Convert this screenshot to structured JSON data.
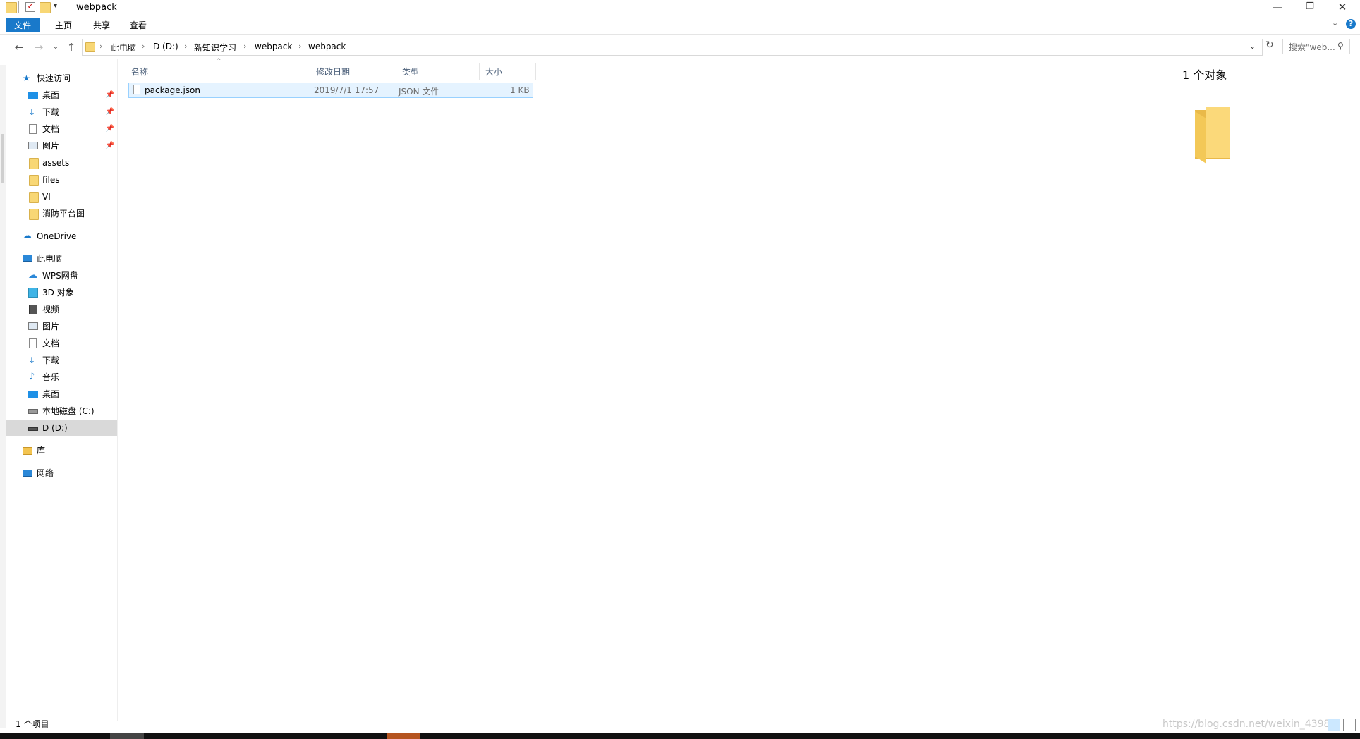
{
  "window": {
    "title": "webpack",
    "controls": {
      "minimize": "—",
      "restore": "❐",
      "close": "✕"
    }
  },
  "ribbon": {
    "tabs": [
      {
        "label": "文件",
        "active": true
      },
      {
        "label": "主页"
      },
      {
        "label": "共享"
      },
      {
        "label": "查看"
      }
    ]
  },
  "address": {
    "crumbs": [
      "此电脑",
      "D (D:)",
      "新知识学习",
      "webpack",
      "webpack"
    ],
    "search_placeholder": "搜索\"web..."
  },
  "sidebar": {
    "quick_access": {
      "label": "快速访问",
      "icon": "star-icon"
    },
    "quick_items": [
      {
        "label": "桌面",
        "icon": "desktop-icon",
        "pinned": true
      },
      {
        "label": "下载",
        "icon": "download-icon",
        "pinned": true
      },
      {
        "label": "文档",
        "icon": "document-icon",
        "pinned": true
      },
      {
        "label": "图片",
        "icon": "pictures-icon",
        "pinned": true
      },
      {
        "label": "assets",
        "icon": "folder-icon"
      },
      {
        "label": "files",
        "icon": "folder-icon"
      },
      {
        "label": "VI",
        "icon": "folder-icon"
      },
      {
        "label": "消防平台图",
        "icon": "folder-icon"
      }
    ],
    "onedrive": {
      "label": "OneDrive",
      "icon": "cloud-icon"
    },
    "this_pc": {
      "label": "此电脑",
      "icon": "computer-icon"
    },
    "pc_items": [
      {
        "label": "WPS网盘",
        "icon": "cloud-drive-icon"
      },
      {
        "label": "3D 对象",
        "icon": "cube-icon"
      },
      {
        "label": "视频",
        "icon": "video-icon"
      },
      {
        "label": "图片",
        "icon": "pictures-icon"
      },
      {
        "label": "文档",
        "icon": "document-icon"
      },
      {
        "label": "下载",
        "icon": "download-icon"
      },
      {
        "label": "音乐",
        "icon": "music-icon"
      },
      {
        "label": "桌面",
        "icon": "desktop-icon"
      },
      {
        "label": "本地磁盘 (C:)",
        "icon": "drive-icon"
      },
      {
        "label": "D (D:)",
        "icon": "drive-icon",
        "selected": true
      }
    ],
    "library": {
      "label": "库",
      "icon": "library-icon"
    },
    "network": {
      "label": "网络",
      "icon": "network-icon"
    }
  },
  "filelist": {
    "columns": [
      "名称",
      "修改日期",
      "类型",
      "大小"
    ],
    "rows": [
      {
        "name": "package.json",
        "modified": "2019/7/1 17:57",
        "type": "JSON 文件",
        "size": "1 KB"
      }
    ]
  },
  "preview": {
    "count": "1 个对象"
  },
  "status": {
    "items": "1 个项目",
    "watermark": "https://blog.csdn.net/weixin_4398"
  },
  "colors": {
    "accent": "#1979ca",
    "selection": "#e5f3ff",
    "folder": "#f8d775"
  }
}
